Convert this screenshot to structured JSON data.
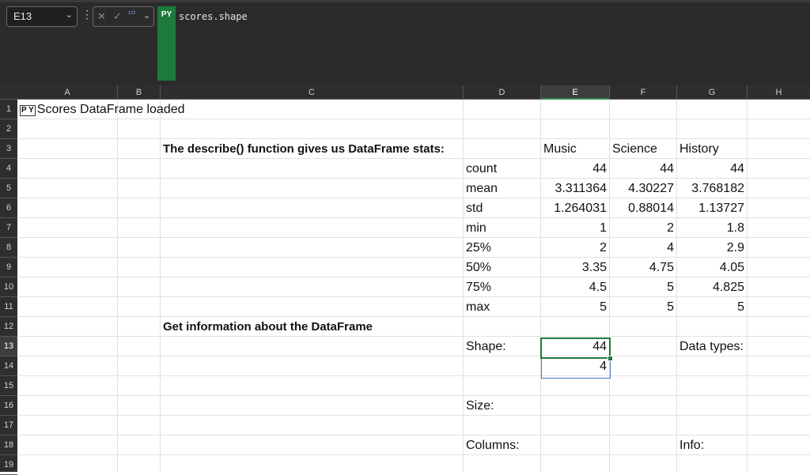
{
  "name_box": {
    "value": "E13"
  },
  "formula_bar": {
    "py_label": "PY",
    "formula": "scores.shape",
    "cancel_symbol": "✕",
    "enter_symbol": "✓",
    "output_symbol": "¹²³"
  },
  "columns": [
    "A",
    "B",
    "C",
    "D",
    "E",
    "F",
    "G",
    "H"
  ],
  "rows": [
    "1",
    "2",
    "3",
    "4",
    "5",
    "6",
    "7",
    "8",
    "9",
    "10",
    "11",
    "12",
    "13",
    "14",
    "15",
    "16",
    "17",
    "18",
    "19"
  ],
  "selected_cell": {
    "column": "E",
    "row": "13"
  },
  "cells": {
    "A1": "Scores DataFrame loaded",
    "A1_py_icon": "P Y",
    "C3": "The describe() function gives us DataFrame stats:",
    "E3": "Music",
    "F3": "Science",
    "G3": "History",
    "D4": "count",
    "E4": "44",
    "F4": "44",
    "G4": "44",
    "D5": "mean",
    "E5": "3.311364",
    "F5": "4.30227",
    "G5": "3.768182",
    "D6": "std",
    "E6": "1.264031",
    "F6": "0.88014",
    "G6": "1.13727",
    "D7": "min",
    "E7": "1",
    "F7": "2",
    "G7": "1.8",
    "D8": "25%",
    "E8": "2",
    "F8": "4",
    "G8": "2.9",
    "D9": "50%",
    "E9": "3.35",
    "F9": "4.75",
    "G9": "4.05",
    "D10": "75%",
    "E10": "4.5",
    "F10": "5",
    "G10": "4.825",
    "D11": "max",
    "E11": "5",
    "F11": "5",
    "G11": "5",
    "C12": "Get information about the DataFrame",
    "D13": "Shape:",
    "E13": "44",
    "G13": "Data types:",
    "E14": "4",
    "D16": "Size:",
    "D18": "Columns:",
    "G18": "Info:"
  },
  "colors": {
    "selection": "#1f7a3c",
    "spill": "#4a78c4",
    "py_badge": "#1e7a3c"
  }
}
